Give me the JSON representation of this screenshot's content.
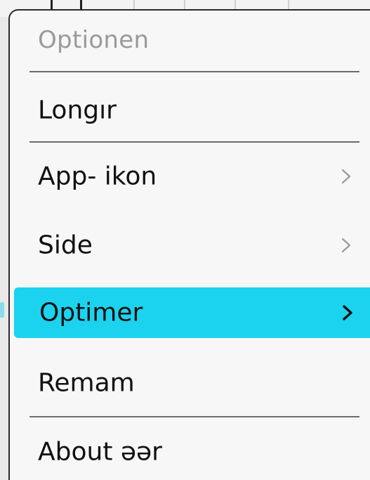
{
  "menu": {
    "header": "Optionen",
    "items": [
      {
        "label": "Longır",
        "has_submenu": false,
        "selected": false
      },
      {
        "label": "App- ikon",
        "has_submenu": true,
        "selected": false
      },
      {
        "label": "Side",
        "has_submenu": true,
        "selected": false
      },
      {
        "label": "Optimer",
        "has_submenu": true,
        "selected": true
      },
      {
        "label": "Remam",
        "has_submenu": false,
        "selected": false
      },
      {
        "label": "About əər",
        "has_submenu": false,
        "selected": false
      }
    ]
  },
  "icons": {
    "submenu_indicator": "chevron-right-icon"
  },
  "colors": {
    "selected_background": "#1cd3ef",
    "header_text": "#9a9a9a",
    "item_text": "#111111",
    "chevron_inactive": "#9a9a9a",
    "chevron_active": "#111111",
    "menu_background": "#f7f7f7",
    "menu_border": "#2a2a2a"
  }
}
